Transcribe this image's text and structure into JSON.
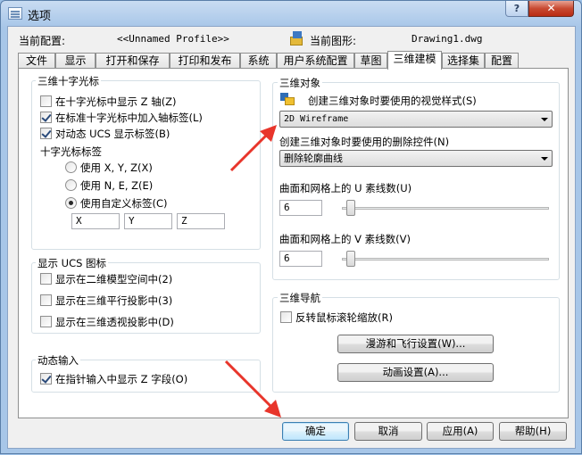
{
  "window": {
    "title": "选项",
    "help_label": "?",
    "close_label": "✕"
  },
  "profile": {
    "label": "当前配置:",
    "value": "<<Unnamed Profile>>",
    "drawing_label": "当前图形:",
    "drawing_value": "Drawing1.dwg"
  },
  "tabs": [
    "文件",
    "显示",
    "打开和保存",
    "打印和发布",
    "系统",
    "用户系统配置",
    "草图",
    "三维建模",
    "选择集",
    "配置"
  ],
  "crosshair": {
    "title": "三维十字光标",
    "show_z_axis": "在十字光标中显示 Z 轴(Z)",
    "axis_labels": "在标准十字光标中加入轴标签(L)",
    "dynamic_ucs": "对动态 UCS 显示标签(B)",
    "labels_title": "十字光标标签",
    "opt_xyz": "使用 X, Y, Z(X)",
    "opt_nez": "使用 N, E, Z(E)",
    "opt_custom": "使用自定义标签(C)",
    "custom_x": "X",
    "custom_y": "Y",
    "custom_z": "Z"
  },
  "ucs_icon": {
    "title": "显示 UCS 图标",
    "in_2d": "显示在二维模型空间中(2)",
    "in_3d_parallel": "显示在三维平行投影中(3)",
    "in_3d_perspective": "显示在三维透视投影中(D)"
  },
  "dynamic_input": {
    "title": "动态输入",
    "show_z": "在指针输入中显示 Z 字段(O)"
  },
  "objects_3d": {
    "title": "三维对象",
    "visual_style_label": "创建三维对象时要使用的视觉样式(S)",
    "visual_style_value": "2D Wireframe",
    "deletion_label": "创建三维对象时要使用的删除控件(N)",
    "deletion_value": "删除轮廓曲线",
    "u_label": "曲面和网格上的 U 素线数(U)",
    "u_value": "6",
    "u_level": 0.0,
    "v_label": "曲面和网格上的 V 素线数(V)",
    "v_value": "6",
    "v_level": 0.0
  },
  "navigation": {
    "title": "三维导航",
    "reverse_wheel": "反转鼠标滚轮缩放(R)",
    "walk_fly_button": "漫游和飞行设置(W)...",
    "animation_button": "动画设置(A)..."
  },
  "footer": {
    "ok": "确定",
    "cancel": "取消",
    "apply": "应用(A)",
    "help": "帮助(H)"
  },
  "colors": {
    "annotation_arrow": "#e8352b",
    "title_bar": "#a7c6e8"
  }
}
